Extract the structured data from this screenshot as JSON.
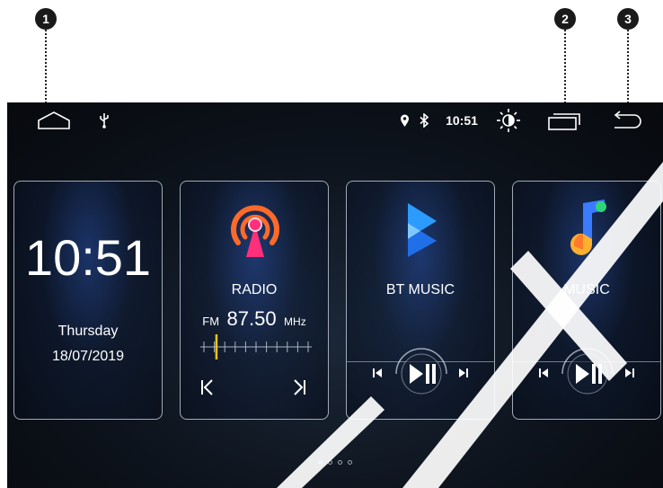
{
  "callouts": {
    "one": "1",
    "two": "2",
    "three": "3"
  },
  "statusbar": {
    "home_icon": "home-outline-icon",
    "usb_icon": "usb-icon",
    "location_icon": "location-pin-icon",
    "bluetooth_icon": "bluetooth-icon",
    "time": "10:51",
    "brightness_icon": "brightness-icon",
    "recents_icon": "recent-apps-icon",
    "back_icon": "back-arrow-icon"
  },
  "clock_card": {
    "time": "10:51",
    "day": "Thursday",
    "date": "18/07/2019"
  },
  "radio_card": {
    "title": "RADIO",
    "band": "FM",
    "frequency": "87.50",
    "unit": "MHz",
    "tuner_position": 0.12
  },
  "bt_card": {
    "title": "BT MUSIC"
  },
  "music_card": {
    "title": "MUSIC"
  },
  "pager": {
    "pages": 4,
    "active": 1
  },
  "colors": {
    "accent": "#2d8cff",
    "radio_orange": "#ff6a2a",
    "radio_pink": "#ff2f7a",
    "tuner_yellow": "#ffc21a",
    "bt_blue": "#2b9bff"
  }
}
